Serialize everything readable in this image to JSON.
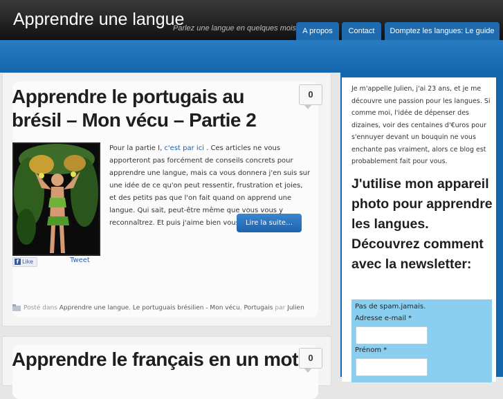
{
  "site": {
    "title": "Apprendre une langue",
    "tagline": "Parlez une langue en quelques mois"
  },
  "nav": {
    "items": [
      {
        "label": "A propos"
      },
      {
        "label": "Contact"
      },
      {
        "label": "Domptez les langues: Le guide"
      }
    ]
  },
  "posts": [
    {
      "title": "Apprendre le portugais au brésil – Mon vécu – Partie 2",
      "comments": "0",
      "excerpt_before_link": "Pour la partie I, ",
      "excerpt_link": "c'est par ici",
      "excerpt_after_link": " . Ces articles ne vous apporteront pas forcément de conseils concrets pour apprendre une langue, mais ca vous donnera j'en suis sur une idée de ce qu'on peut ressentir, frustration et joies, et des petits pas que l'on fait quand on apprend une langue. Qui sait, peut-être même que vous vous y reconnaîtrez. Et puis j'aime bien vous raconter ma vie.",
      "read_more": "Lire la suite…",
      "like_label": "Like",
      "tweet_label": "Tweet",
      "meta_prefix": "Posté dans",
      "categories": [
        "Apprendre une langue",
        "Le portuguais brésilien - Mon vécu",
        "Portugais"
      ],
      "author_prefix": "par",
      "author": "Julien"
    },
    {
      "title": "Apprendre le français en un mot",
      "comments": "0"
    }
  ],
  "sidebar": {
    "intro": "Je m'appelle Julien, j'ai 23 ans, et je me découvre une passion pour les langues. Si comme moi, l'idée de dépenser des dizaines, voir des centaines d'€uros pour s'ennuyer devant un bouquin ne vous enchante pas vraiment, alors ce blog est probablement fait pour vous.",
    "heading": "J'utilise mon appareil photo pour apprendre les langues. Découvrez comment avec la newsletter:",
    "newsletter": {
      "no_spam": "Pas de spam.jamais.",
      "email_label": "Adresse e-mail *",
      "firstname_label": "Prénom *"
    }
  },
  "colors": {
    "accent_blue": "#1566ad",
    "header_dark": "#1a1a1a",
    "newsletter_bg": "#8bcff0",
    "link": "#1e5fa8"
  }
}
